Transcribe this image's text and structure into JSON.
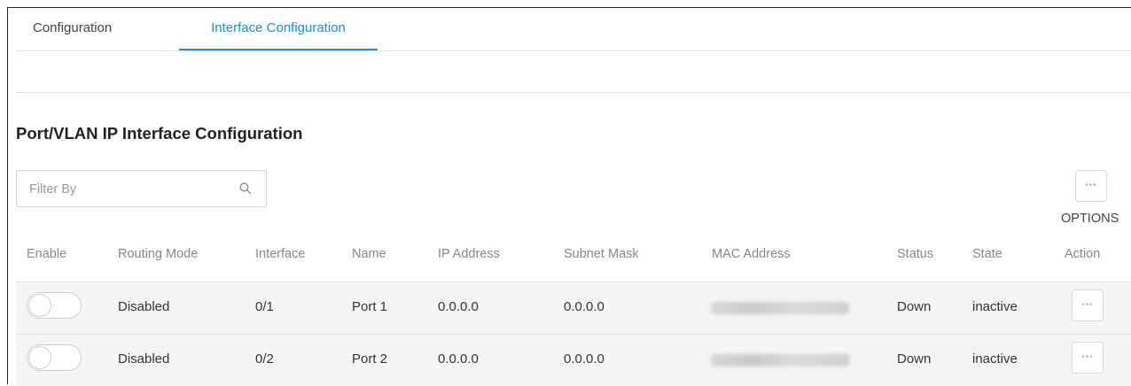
{
  "tabs": [
    {
      "label": "Configuration"
    },
    {
      "label": "Interface Configuration"
    }
  ],
  "section_title": "Port/VLAN IP Interface Configuration",
  "filter": {
    "placeholder": "Filter By",
    "value": ""
  },
  "options_label": "OPTIONS",
  "table": {
    "columns": [
      "Enable",
      "Routing Mode",
      "Interface",
      "Name",
      "IP Address",
      "Subnet Mask",
      "MAC Address",
      "Status",
      "State",
      "Action"
    ],
    "rows": [
      {
        "enabled": false,
        "routing_mode": "Disabled",
        "interface": "0/1",
        "name": "Port 1",
        "ip": "0.0.0.0",
        "mask": "0.0.0.0",
        "status": "Down",
        "state": "inactive"
      },
      {
        "enabled": false,
        "routing_mode": "Disabled",
        "interface": "0/2",
        "name": "Port 2",
        "ip": "0.0.0.0",
        "mask": "0.0.0.0",
        "status": "Down",
        "state": "inactive"
      }
    ]
  },
  "colors": {
    "accent": "#1a8fe0",
    "row_bg": "#f5f5f5",
    "header_text": "#888888"
  },
  "icons": {
    "filter": "search-icon",
    "options": "more-dots-icon",
    "action": "more-dots-icon"
  }
}
